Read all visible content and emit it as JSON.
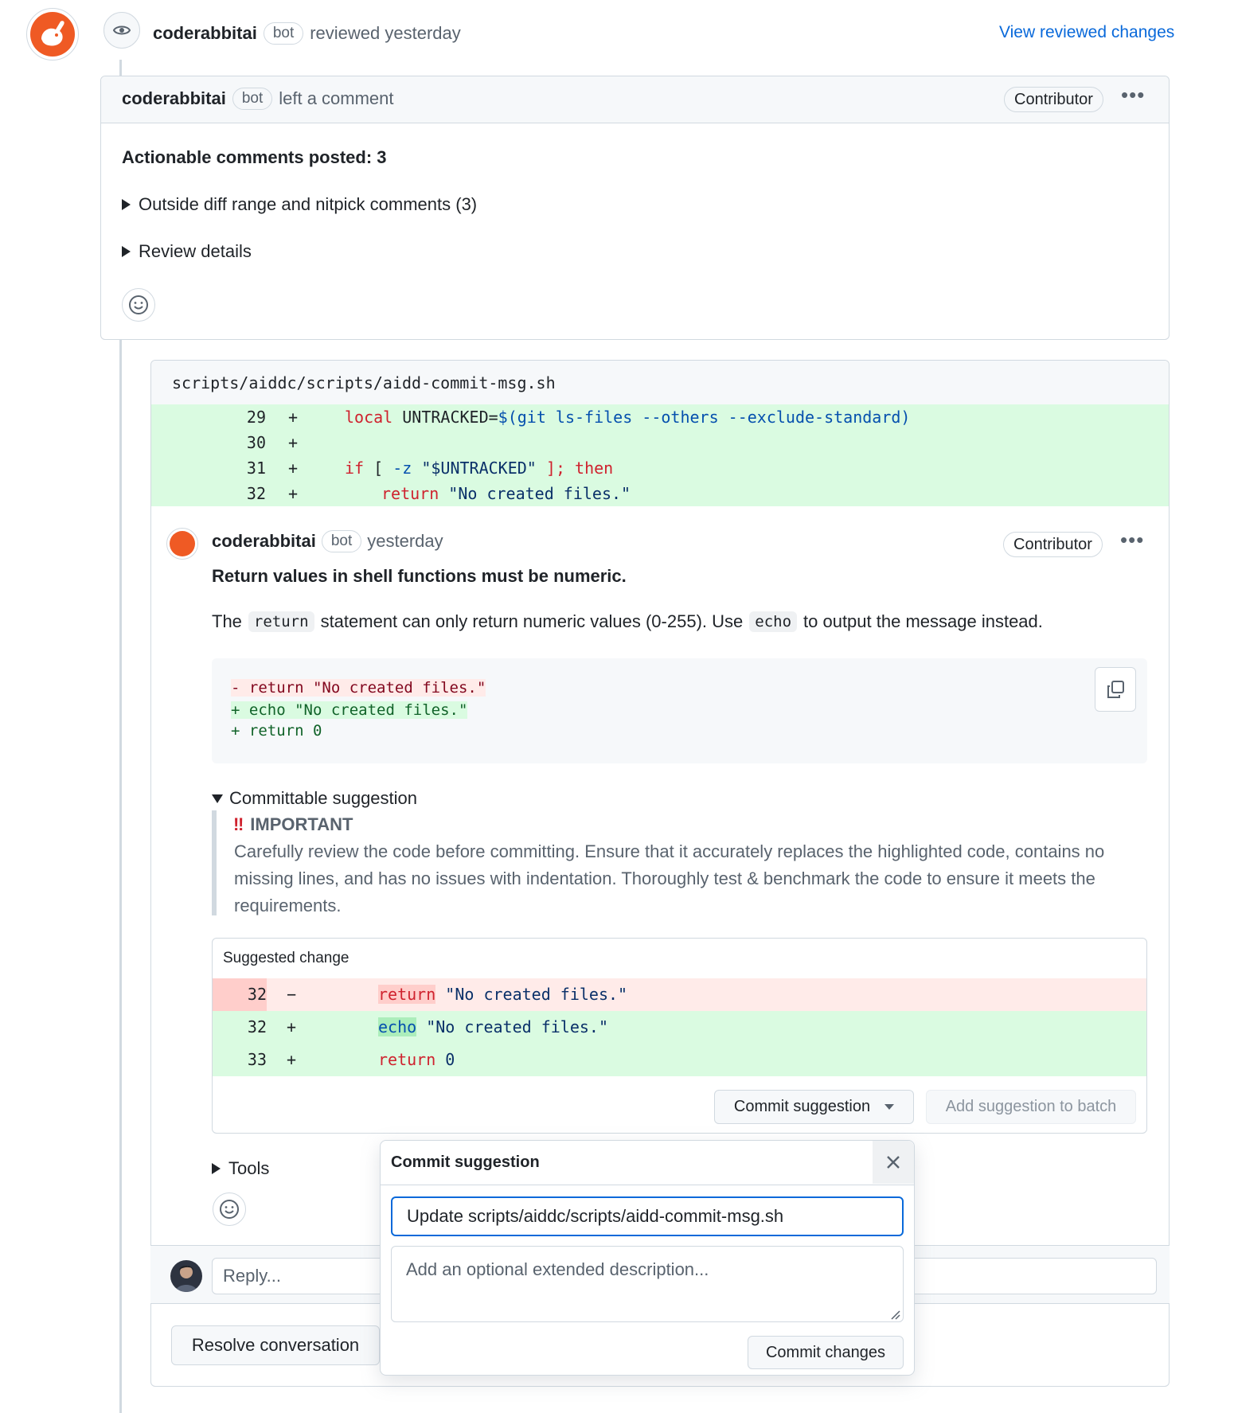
{
  "review_header": {
    "author": "coderabbitai",
    "bot_label": "bot",
    "action": "reviewed yesterday",
    "view_changes_link": "View reviewed changes"
  },
  "review_comment": {
    "author": "coderabbitai",
    "bot_label": "bot",
    "action": "left a comment",
    "role_badge": "Contributor",
    "more_icon": "kebab-horizontal-icon",
    "heading": "Actionable comments posted: 3",
    "details": [
      "Outside diff range and nitpick comments (3)",
      "Review details"
    ]
  },
  "file_thread": {
    "file_path": "scripts/aiddc/scripts/aidd-commit-msg.sh",
    "diff_lines": [
      {
        "num": "29",
        "sign": "+"
      },
      {
        "num": "30",
        "sign": "+"
      },
      {
        "num": "31",
        "sign": "+"
      },
      {
        "num": "32",
        "sign": "+"
      }
    ],
    "diff_code": {
      "l29_kw": "local",
      "l29_rest": " UNTRACKED=",
      "l29_sub": "$(git ls-files --others --exclude-standard)",
      "l31_if": "if",
      "l31_mid": " [ ",
      "l31_flag": "-z",
      "l31_str": " \"$UNTRACKED\"",
      "l31_end": " ];",
      "l31_then": " then",
      "l32_kw": "return",
      "l32_str": " \"No created files.\""
    }
  },
  "thread_comment": {
    "author": "coderabbitai",
    "bot_label": "bot",
    "time": "yesterday",
    "role_badge": "Contributor",
    "title": "Return values in shell functions must be numeric.",
    "body_pre": "The",
    "body_code1": "return",
    "body_mid": "statement can only return numeric values (0-255). Use",
    "body_code2": "echo",
    "body_post": "to output the message instead.",
    "diff_block": [
      "- return \"No created files.\"",
      "+ echo \"No created files.\"",
      "+ return 0"
    ],
    "committable_label": "Committable suggestion",
    "important_title": "IMPORTANT",
    "important_body": "Carefully review the code before committing. Ensure that it accurately replaces the highlighted code, contains no missing lines, and has no issues with indentation. Thoroughly test & benchmark the code to ensure it meets the requirements.",
    "suggested_change_label": "Suggested change",
    "suggestion_rows": [
      {
        "num": "32",
        "sign": "−",
        "kw": "return",
        "rest": " \"No created files.\""
      },
      {
        "num": "32",
        "sign": "+",
        "kw": "echo",
        "rest": " \"No created files.\""
      },
      {
        "num": "33",
        "sign": "+",
        "kw": "return",
        "rest": " 0"
      }
    ],
    "commit_suggestion_button": "Commit suggestion",
    "add_to_batch_button": "Add suggestion to batch",
    "tools_label": "Tools"
  },
  "reply": {
    "placeholder": "Reply...",
    "resolve_button": "Resolve conversation"
  },
  "commit_popover": {
    "title": "Commit suggestion",
    "message_value": "Update scripts/aiddc/scripts/aidd-commit-msg.sh",
    "description_placeholder": "Add an optional extended description...",
    "commit_button": "Commit changes"
  },
  "colors": {
    "link": "#0969da",
    "addition_bg": "#dafbe1",
    "deletion_bg": "#ffebe9",
    "brand_orange": "#ef5a24",
    "important_red": "#cf222e"
  }
}
